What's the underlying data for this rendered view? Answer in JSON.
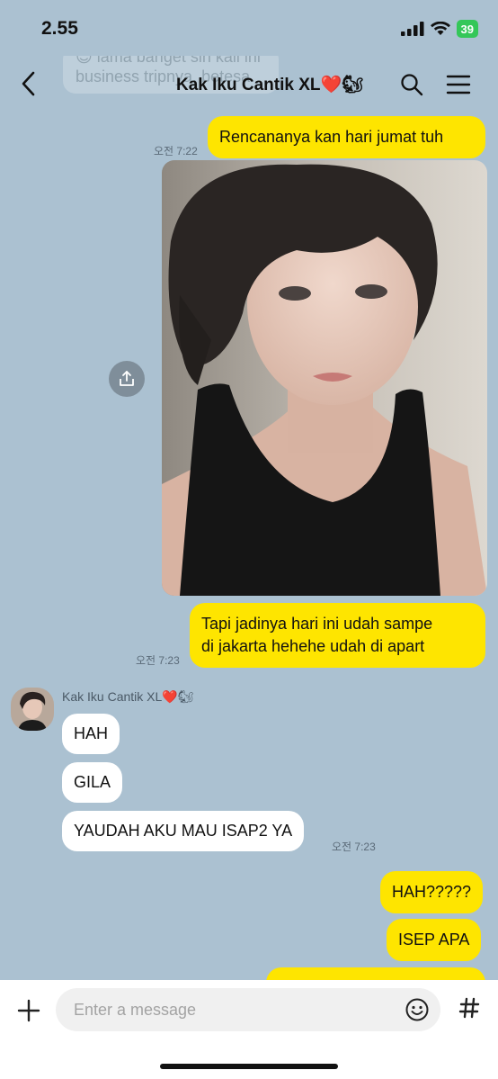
{
  "status_bar": {
    "time": "2.55",
    "battery": "39"
  },
  "header": {
    "title": "Kak Iku Cantik XL❤️🐿",
    "faded_preview_line1": "😊 lama banget sih kali ini",
    "faded_preview_line2": "business tripnya, betesa"
  },
  "messages": {
    "m1": {
      "text": "Rencananya kan hari jumat tuh",
      "time": "오전 7:22"
    },
    "photo_time": "",
    "m2": {
      "line1": "Tapi jadinya hari ini udah sampe",
      "line2": "di jakarta hehehe udah di apart",
      "time": "오전 7:23"
    },
    "sender_name": "Kak Iku Cantik XL❤️🐿",
    "t1": "HAH",
    "t2": "GILA",
    "t3": {
      "text": "YAUDAH AKU MAU ISAP2 YA",
      "time": "오전 7:23"
    },
    "m3": "HAH?????",
    "m4": "ISEP APA"
  },
  "composer": {
    "placeholder": "Enter a message"
  },
  "colors": {
    "background": "#abc1d1",
    "my_bubble": "#fee500",
    "their_bubble": "#ffffff"
  }
}
